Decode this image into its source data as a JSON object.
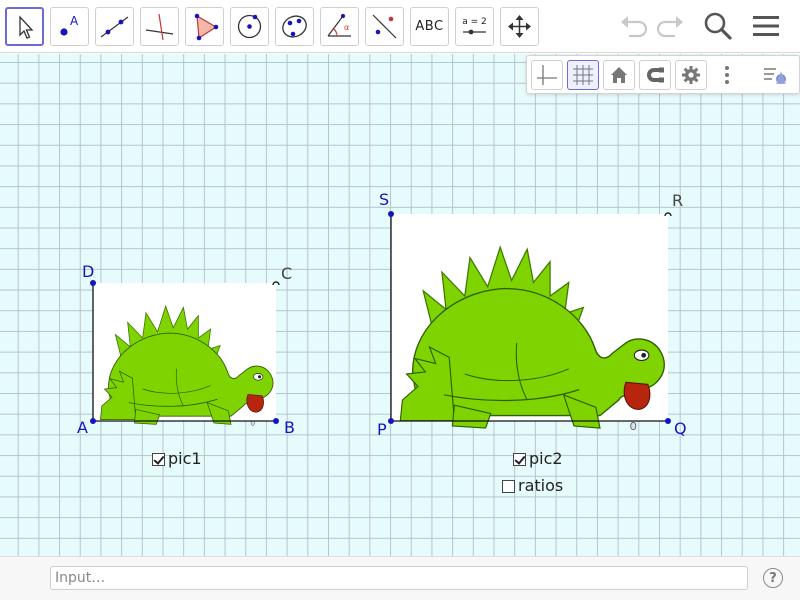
{
  "toolbar": {
    "tools": [
      {
        "name": "move-tool-icon"
      },
      {
        "name": "point-tool-icon",
        "label": "A"
      },
      {
        "name": "line-tool-icon"
      },
      {
        "name": "perpendicular-line-tool-icon"
      },
      {
        "name": "polygon-tool-icon"
      },
      {
        "name": "circle-tool-icon"
      },
      {
        "name": "conic-tool-icon"
      },
      {
        "name": "angle-tool-icon"
      },
      {
        "name": "reflect-tool-icon"
      },
      {
        "name": "text-tool-icon",
        "label": "ABC"
      },
      {
        "name": "slider-tool-icon",
        "label": "a = 2"
      },
      {
        "name": "move-graphics-view-tool-icon"
      }
    ],
    "right": [
      "undo-icon",
      "redo-icon",
      "search-icon",
      "menu-icon"
    ]
  },
  "stylebar": {
    "items": [
      "axes-toggle-icon",
      "grid-toggle-icon",
      "home-view-icon",
      "point-capturing-icon",
      "graphics-settings-icon",
      "more-options-icon",
      "style-bar-toggle-icon"
    ],
    "grid_active": true
  },
  "graphics": {
    "colors": {
      "background": "#e6fbfc",
      "grid": "#b9c3cc",
      "point": "#1515c0",
      "polygon_edge": "#111111",
      "dino_green": "#7fd300",
      "dino_dark": "#4ea000",
      "tongue": "#b8250f"
    },
    "points": {
      "A": "A",
      "B": "B",
      "C": "C",
      "D": "D",
      "P": "P",
      "Q": "Q",
      "R": "R",
      "S": "S"
    },
    "checkboxes": [
      {
        "id": "pic1",
        "label": "pic1",
        "checked": true
      },
      {
        "id": "pic2",
        "label": "pic2",
        "checked": true
      },
      {
        "id": "ratios",
        "label": "ratios",
        "checked": false
      }
    ]
  },
  "input": {
    "placeholder": "Input…",
    "help_label": "?"
  }
}
